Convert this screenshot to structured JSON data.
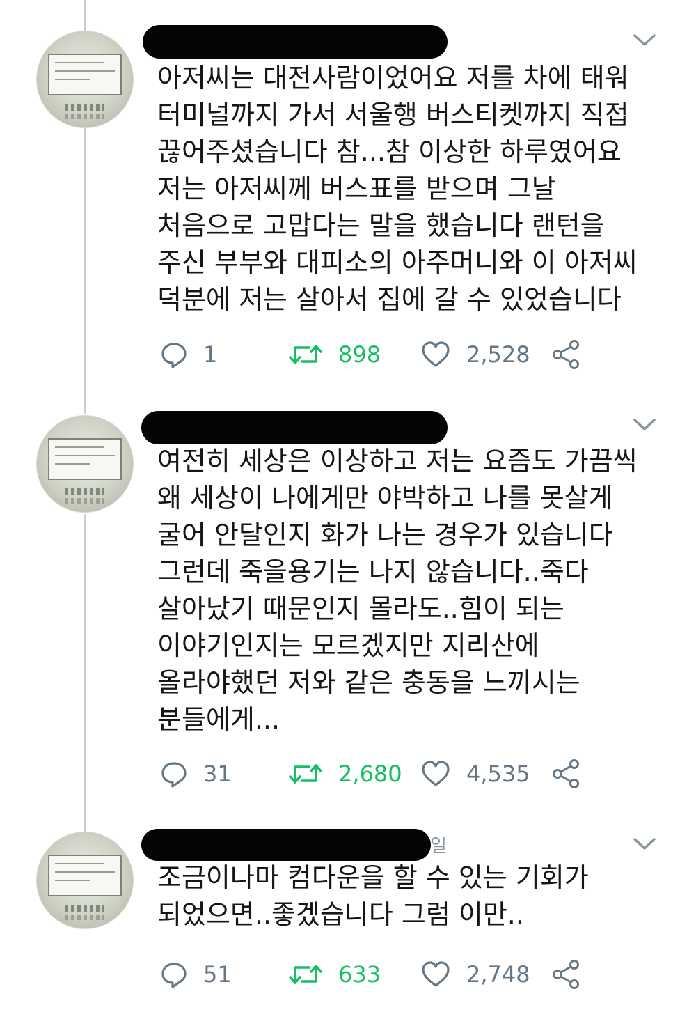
{
  "tweets": [
    {
      "handle_tail": "",
      "text_lines": [
        "아저씨는 대전사람이었어요 저를 차에 태워",
        "터미널까지 가서 서울행 버스티켓까지 직접",
        "끊어주셨습니다 참...참 이상한 하루였어요",
        "저는 아저씨께 버스표를 받으며 그날",
        "처음으로 고맙다는 말을 했습니다 랜턴을",
        "주신 부부와 대피소의 아주머니와 이 아저씨",
        "덕분에 저는 살아서 집에 갈 수 있었습니다"
      ],
      "replies": "1",
      "retweets": "898",
      "likes": "2,528",
      "retweeted": true
    },
    {
      "handle_tail": "",
      "text_lines": [
        "여전히 세상은 이상하고 저는 요즘도 가끔씩",
        "왜 세상이 나에게만 야박하고 나를 못살게",
        "굴어 안달인지 화가 나는 경우가 있습니다",
        "그런데 죽을용기는 나지 않습니다..죽다",
        "살아났기 때문인지 몰라도..힘이 되는",
        "이야기인지는 모르겠지만 지리산에",
        "올라야했던 저와 같은 충동을 느끼시는",
        "분들에게..."
      ],
      "replies": "31",
      "retweets": "2,680",
      "likes": "4,535",
      "retweeted": true
    },
    {
      "handle_tail": "일",
      "text_lines": [
        "조금이나마 컴다운을 할 수 있는 기회가",
        "되었으면..좋겠습니다 그럼 이만.."
      ],
      "replies": "51",
      "retweets": "633",
      "likes": "2,748",
      "retweeted": true
    }
  ],
  "icons": {
    "reply": "reply-icon",
    "retweet": "retweet-icon",
    "like": "heart-icon",
    "share": "share-icon",
    "more": "chevron-down-icon"
  },
  "colors": {
    "text": "#14171a",
    "muted": "#657786",
    "retweet_active": "#17bf63",
    "thread_line": "#c8d0d6"
  }
}
